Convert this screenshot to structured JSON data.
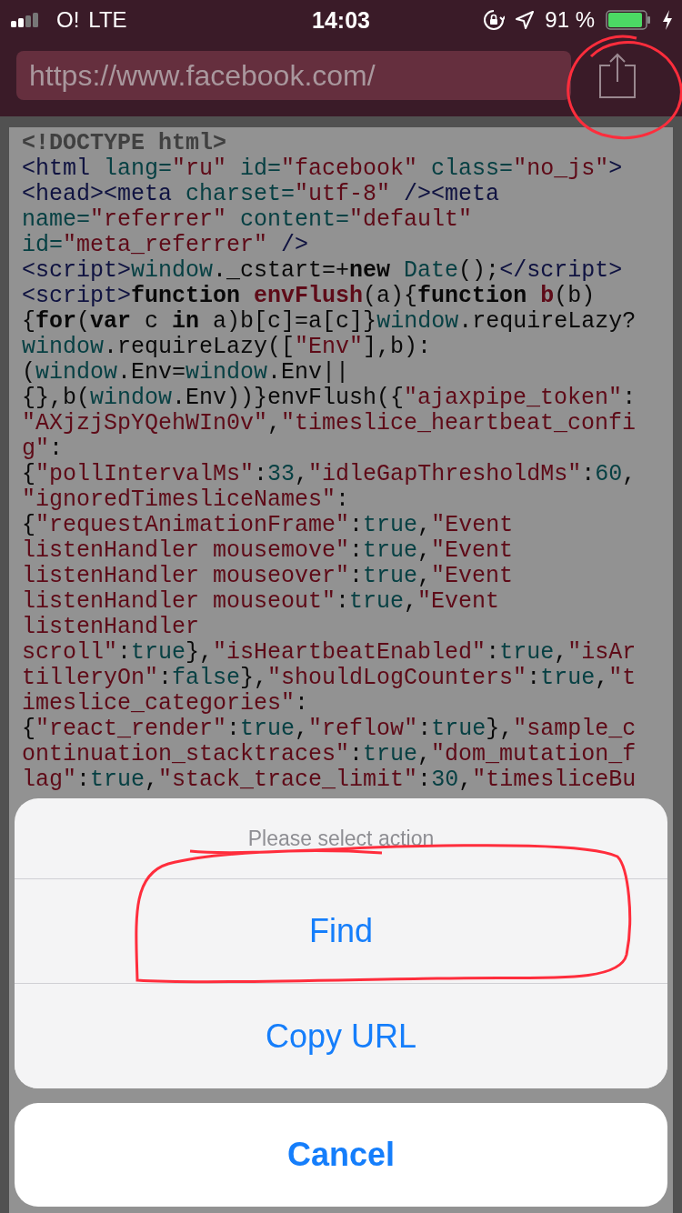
{
  "status_bar": {
    "carrier": "O!",
    "network": "LTE",
    "time": "14:03",
    "battery": "91 %"
  },
  "address_bar": {
    "url": "https://www.facebook.com/"
  },
  "source_code": {
    "lines": [
      [
        {
          "kind": "doctype",
          "text": "<!DOCTYPE html>"
        }
      ],
      [
        {
          "kind": "tag",
          "text": "<html"
        },
        {
          "kind": "attr",
          "text": " lang="
        },
        {
          "kind": "str",
          "text": "\"ru\""
        },
        {
          "kind": "attr",
          "text": " id="
        },
        {
          "kind": "str",
          "text": "\"facebook\""
        },
        {
          "kind": "attr",
          "text": " class="
        },
        {
          "kind": "str",
          "text": "\"no_js\""
        },
        {
          "kind": "tag",
          "text": ">"
        }
      ],
      [
        {
          "kind": "tag",
          "text": "<head><meta"
        },
        {
          "kind": "attr",
          "text": " charset="
        },
        {
          "kind": "str",
          "text": "\"utf-8\""
        },
        {
          "kind": "tag",
          "text": " /><meta"
        }
      ],
      [
        {
          "kind": "attr",
          "text": "name="
        },
        {
          "kind": "str",
          "text": "\"referrer\""
        },
        {
          "kind": "attr",
          "text": " content="
        },
        {
          "kind": "str",
          "text": "\"default\""
        }
      ],
      [
        {
          "kind": "attr",
          "text": "id="
        },
        {
          "kind": "str",
          "text": "\"meta_referrer\""
        },
        {
          "kind": "tag",
          "text": " />"
        }
      ],
      [
        {
          "kind": "tag",
          "text": "<script>"
        },
        {
          "kind": "attr",
          "text": "window"
        },
        {
          "kind": "plain",
          "text": "._cstart=+"
        },
        {
          "kind": "kw",
          "text": "new"
        },
        {
          "kind": "attr",
          "text": " Date"
        },
        {
          "kind": "plain",
          "text": "();"
        },
        {
          "kind": "tag",
          "text": "</script>"
        }
      ],
      [
        {
          "kind": "tag",
          "text": "<script>"
        },
        {
          "kind": "kw",
          "text": "function "
        },
        {
          "kind": "fn",
          "text": "envFlush"
        },
        {
          "kind": "plain",
          "text": "(a){"
        },
        {
          "kind": "kw",
          "text": "function "
        },
        {
          "kind": "fn",
          "text": "b"
        },
        {
          "kind": "plain",
          "text": "(b)"
        }
      ],
      [
        {
          "kind": "plain",
          "text": "{"
        },
        {
          "kind": "kw",
          "text": "for"
        },
        {
          "kind": "plain",
          "text": "("
        },
        {
          "kind": "kw",
          "text": "var"
        },
        {
          "kind": "plain",
          "text": " c "
        },
        {
          "kind": "kw",
          "text": "in"
        },
        {
          "kind": "plain",
          "text": " a)b[c]=a[c]}"
        },
        {
          "kind": "attr",
          "text": "window"
        },
        {
          "kind": "plain",
          "text": ".requireLazy?"
        }
      ],
      [
        {
          "kind": "attr",
          "text": "window"
        },
        {
          "kind": "plain",
          "text": ".requireLazy(["
        },
        {
          "kind": "str",
          "text": "\"Env\""
        },
        {
          "kind": "plain",
          "text": "],b):"
        }
      ],
      [
        {
          "kind": "plain",
          "text": "("
        },
        {
          "kind": "attr",
          "text": "window"
        },
        {
          "kind": "plain",
          "text": ".Env="
        },
        {
          "kind": "attr",
          "text": "window"
        },
        {
          "kind": "plain",
          "text": ".Env||"
        }
      ],
      [
        {
          "kind": "plain",
          "text": "{},b("
        },
        {
          "kind": "attr",
          "text": "window"
        },
        {
          "kind": "plain",
          "text": ".Env))}envFlush({"
        },
        {
          "kind": "str",
          "text": "\"ajaxpipe_token\""
        },
        {
          "kind": "plain",
          "text": ":"
        }
      ],
      [
        {
          "kind": "str",
          "text": "\"AXjzjSpYQehWIn0v\""
        },
        {
          "kind": "plain",
          "text": ","
        },
        {
          "kind": "str",
          "text": "\"timeslice_heartbeat_confi"
        }
      ],
      [
        {
          "kind": "str",
          "text": "g\""
        },
        {
          "kind": "plain",
          "text": ":"
        }
      ],
      [
        {
          "kind": "plain",
          "text": "{"
        },
        {
          "kind": "str",
          "text": "\"pollIntervalMs\""
        },
        {
          "kind": "plain",
          "text": ":"
        },
        {
          "kind": "num",
          "text": "33"
        },
        {
          "kind": "plain",
          "text": ","
        },
        {
          "kind": "str",
          "text": "\"idleGapThresholdMs\""
        },
        {
          "kind": "plain",
          "text": ":"
        },
        {
          "kind": "num",
          "text": "60"
        },
        {
          "kind": "plain",
          "text": ","
        }
      ],
      [
        {
          "kind": "str",
          "text": "\"ignoredTimesliceNames\""
        },
        {
          "kind": "plain",
          "text": ":"
        }
      ],
      [
        {
          "kind": "plain",
          "text": "{"
        },
        {
          "kind": "str",
          "text": "\"requestAnimationFrame\""
        },
        {
          "kind": "plain",
          "text": ":"
        },
        {
          "kind": "num",
          "text": "true"
        },
        {
          "kind": "plain",
          "text": ","
        },
        {
          "kind": "str",
          "text": "\"Event"
        }
      ],
      [
        {
          "kind": "str",
          "text": "listenHandler mousemove\""
        },
        {
          "kind": "plain",
          "text": ":"
        },
        {
          "kind": "num",
          "text": "true"
        },
        {
          "kind": "plain",
          "text": ","
        },
        {
          "kind": "str",
          "text": "\"Event"
        }
      ],
      [
        {
          "kind": "str",
          "text": "listenHandler mouseover\""
        },
        {
          "kind": "plain",
          "text": ":"
        },
        {
          "kind": "num",
          "text": "true"
        },
        {
          "kind": "plain",
          "text": ","
        },
        {
          "kind": "str",
          "text": "\"Event"
        }
      ],
      [
        {
          "kind": "str",
          "text": "listenHandler mouseout\""
        },
        {
          "kind": "plain",
          "text": ":"
        },
        {
          "kind": "num",
          "text": "true"
        },
        {
          "kind": "plain",
          "text": ","
        },
        {
          "kind": "str",
          "text": "\"Event"
        }
      ],
      [
        {
          "kind": "str",
          "text": "listenHandler"
        }
      ],
      [
        {
          "kind": "str",
          "text": "scroll\""
        },
        {
          "kind": "plain",
          "text": ":"
        },
        {
          "kind": "num",
          "text": "true"
        },
        {
          "kind": "plain",
          "text": "},"
        },
        {
          "kind": "str",
          "text": "\"isHeartbeatEnabled\""
        },
        {
          "kind": "plain",
          "text": ":"
        },
        {
          "kind": "num",
          "text": "true"
        },
        {
          "kind": "plain",
          "text": ","
        },
        {
          "kind": "str",
          "text": "\"isAr"
        }
      ],
      [
        {
          "kind": "str",
          "text": "tilleryOn\""
        },
        {
          "kind": "plain",
          "text": ":"
        },
        {
          "kind": "num",
          "text": "false"
        },
        {
          "kind": "plain",
          "text": "},"
        },
        {
          "kind": "str",
          "text": "\"shouldLogCounters\""
        },
        {
          "kind": "plain",
          "text": ":"
        },
        {
          "kind": "num",
          "text": "true"
        },
        {
          "kind": "plain",
          "text": ","
        },
        {
          "kind": "str",
          "text": "\"t"
        }
      ],
      [
        {
          "kind": "str",
          "text": "imeslice_categories\""
        },
        {
          "kind": "plain",
          "text": ":"
        }
      ],
      [
        {
          "kind": "plain",
          "text": "{"
        },
        {
          "kind": "str",
          "text": "\"react_render\""
        },
        {
          "kind": "plain",
          "text": ":"
        },
        {
          "kind": "num",
          "text": "true"
        },
        {
          "kind": "plain",
          "text": ","
        },
        {
          "kind": "str",
          "text": "\"reflow\""
        },
        {
          "kind": "plain",
          "text": ":"
        },
        {
          "kind": "num",
          "text": "true"
        },
        {
          "kind": "plain",
          "text": "},"
        },
        {
          "kind": "str",
          "text": "\"sample_c"
        }
      ],
      [
        {
          "kind": "str",
          "text": "ontinuation_stacktraces\""
        },
        {
          "kind": "plain",
          "text": ":"
        },
        {
          "kind": "num",
          "text": "true"
        },
        {
          "kind": "plain",
          "text": ","
        },
        {
          "kind": "str",
          "text": "\"dom_mutation_f"
        }
      ],
      [
        {
          "kind": "str",
          "text": "lag\""
        },
        {
          "kind": "plain",
          "text": ":"
        },
        {
          "kind": "num",
          "text": "true"
        },
        {
          "kind": "plain",
          "text": ","
        },
        {
          "kind": "str",
          "text": "\"stack_trace_limit\""
        },
        {
          "kind": "plain",
          "text": ":"
        },
        {
          "kind": "num",
          "text": "30"
        },
        {
          "kind": "plain",
          "text": ","
        },
        {
          "kind": "str",
          "text": "\"timesliceBu"
        }
      ]
    ]
  },
  "action_sheet": {
    "title": "Please select action",
    "actions": [
      "Find",
      "Copy URL"
    ],
    "cancel": "Cancel"
  }
}
